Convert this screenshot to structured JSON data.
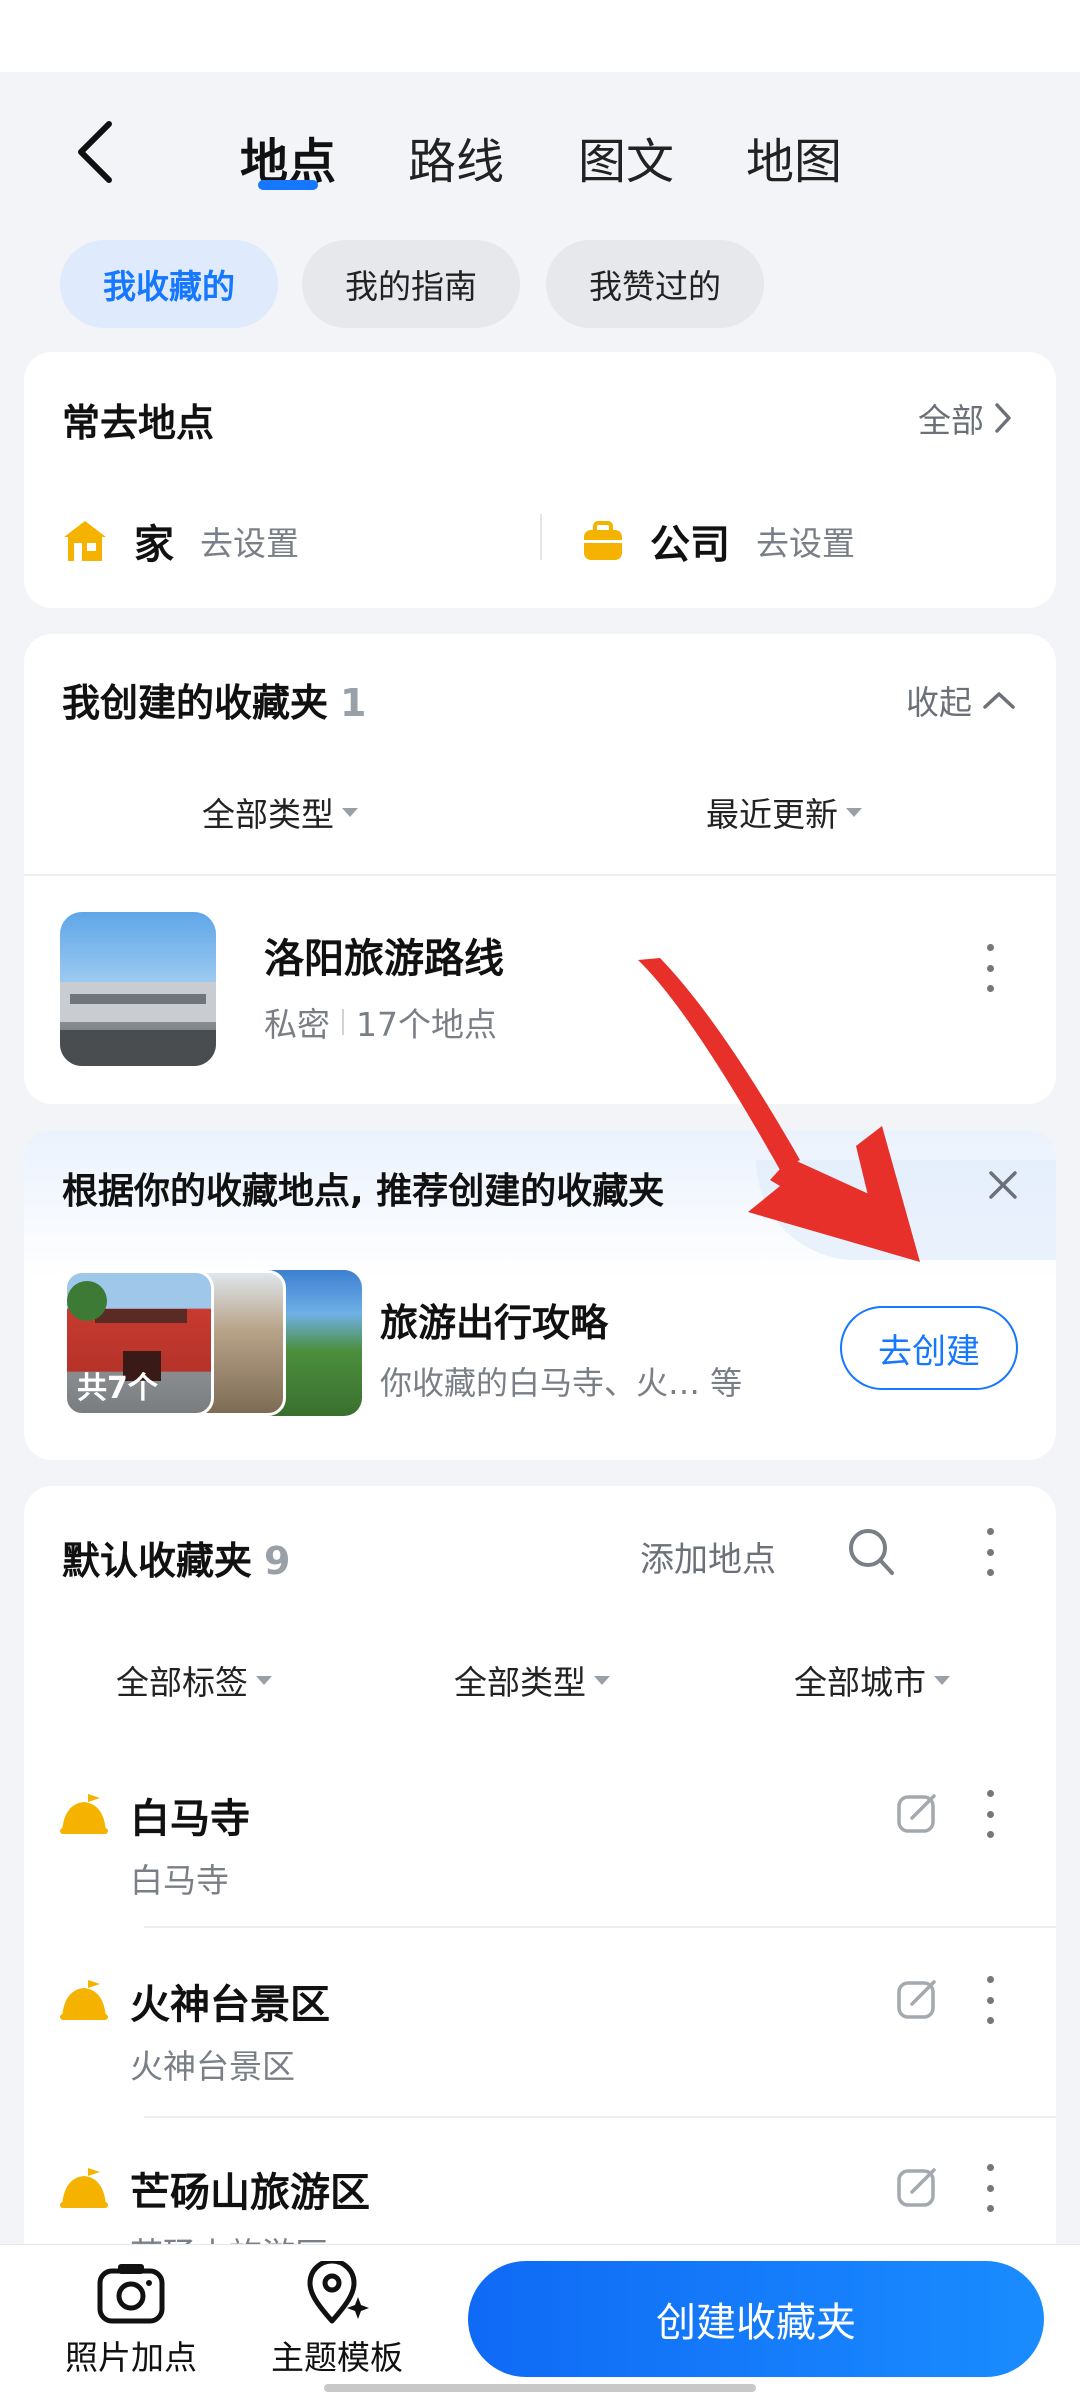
{
  "nav": {
    "tabs": [
      "地点",
      "路线",
      "图文",
      "地图"
    ],
    "active_tab": "地点"
  },
  "chips": [
    "我收藏的",
    "我的指南",
    "我赞过的"
  ],
  "frequent": {
    "title": "常去地点",
    "all_label": "全部",
    "home_label": "家",
    "home_action": "去设置",
    "work_label": "公司",
    "work_action": "去设置"
  },
  "my_folders": {
    "title": "我创建的收藏夹",
    "count": "1",
    "collapse_label": "收起",
    "filter_type": "全部类型",
    "filter_sort": "最近更新",
    "folder": {
      "name": "洛阳旅游路线",
      "privacy": "私密",
      "places": "17个地点"
    }
  },
  "recommend": {
    "title": "根据你的收藏地点, 推荐创建的收藏夹",
    "name": "旅游出行攻略",
    "desc": "你收藏的白马寺、火… 等",
    "count_badge": "共7个",
    "action": "去创建"
  },
  "default_folder": {
    "title": "默认收藏夹",
    "count": "9",
    "add_label": "添加地点",
    "filters": [
      "全部标签",
      "全部类型",
      "全部城市"
    ],
    "items": [
      {
        "name": "白马寺",
        "sub": "白马寺"
      },
      {
        "name": "火神台景区",
        "sub": "火神台景区"
      },
      {
        "name": "芒砀山旅游区",
        "sub": "芒砀山旅游区"
      }
    ]
  },
  "bottom": {
    "photo_label": "照片加点",
    "template_label": "主题模板",
    "create_label": "创建收藏夹"
  },
  "colors": {
    "accent": "#1677ff",
    "icon_yellow": "#f5b300",
    "background": "#f2f4f7"
  }
}
